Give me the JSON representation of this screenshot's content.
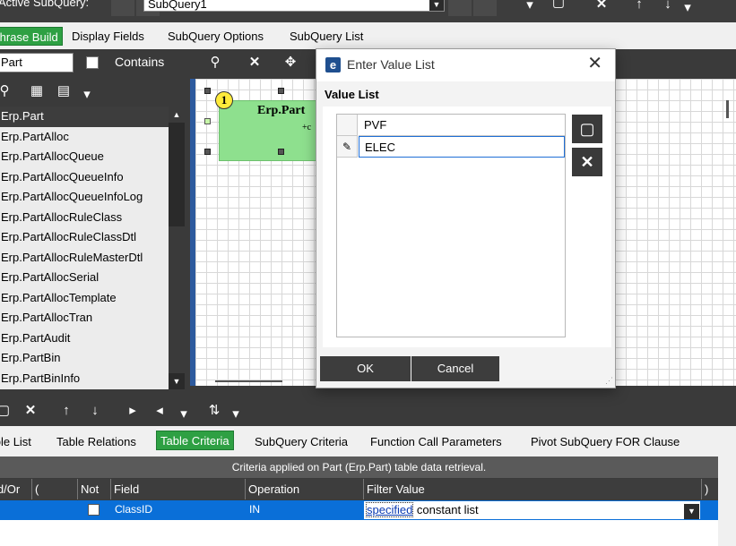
{
  "topbar": {
    "active_label": "Active SubQuery:",
    "subquery_value": "SubQuery1"
  },
  "tabs": [
    {
      "label": "Phrase Build"
    },
    {
      "label": "Display Fields"
    },
    {
      "label": "SubQuery Options"
    },
    {
      "label": "SubQuery List"
    }
  ],
  "left": {
    "filter_value": "Part",
    "contains_label": "Contains",
    "tables": [
      "Erp.Part",
      "Erp.PartAlloc",
      "Erp.PartAllocQueue",
      "Erp.PartAllocQueueInfo",
      "Erp.PartAllocQueueInfoLog",
      "Erp.PartAllocRuleClass",
      "Erp.PartAllocRuleClassDtl",
      "Erp.PartAllocRuleMasterDtl",
      "Erp.PartAllocSerial",
      "Erp.PartAllocTemplate",
      "Erp.PartAllocTran",
      "Erp.PartAudit",
      "Erp.PartBin",
      "Erp.PartBinInfo"
    ]
  },
  "diagram": {
    "badge": "1",
    "box_title": "Erp.Part",
    "box_sub": "+c"
  },
  "dialog": {
    "title": "Enter Value List",
    "section_label": "Value List",
    "values": [
      "PVF",
      "ELEC"
    ],
    "ok_label": "OK",
    "cancel_label": "Cancel"
  },
  "bottom_tabs": [
    {
      "label": "Table List"
    },
    {
      "label": "Table Relations"
    },
    {
      "label": "Table Criteria"
    },
    {
      "label": "SubQuery Criteria"
    },
    {
      "label": "Function Call Parameters"
    },
    {
      "label": "Pivot SubQuery FOR Clause"
    }
  ],
  "criteria": {
    "caption": "Criteria applied on Part (Erp.Part)  table data retrieval.",
    "headers": {
      "and_or": "And/Or",
      "lparen": "(",
      "not": "Not",
      "field": "Field",
      "operation": "Operation",
      "filter_value": "Filter Value",
      "rparen": ")"
    },
    "row": {
      "field": "ClassID",
      "operation": "IN",
      "filter_link": "specified",
      "filter_text": " constant list"
    }
  }
}
